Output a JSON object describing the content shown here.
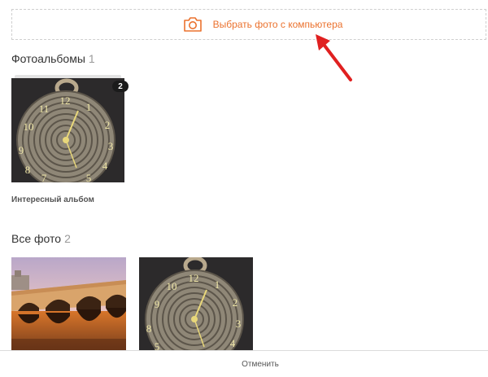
{
  "upload": {
    "label": "Выбрать фото с компьютера",
    "icon": "camera-icon",
    "color": "#eb722e"
  },
  "annotation": {
    "icon": "red-arrow-icon",
    "color": "#e02020"
  },
  "albums_section": {
    "title": "Фотоальбомы",
    "count": "1"
  },
  "albums": [
    {
      "name": "Интересный альбом",
      "photo_count": "2",
      "numerals": [
        "12",
        "1",
        "2",
        "3",
        "4",
        "5",
        "7",
        "8",
        "9",
        "10",
        "11"
      ]
    }
  ],
  "photos_section": {
    "title": "Все фото",
    "count": "2"
  },
  "photos": [
    {
      "kind": "bridge-landscape"
    },
    {
      "kind": "rope-clock",
      "numerals": [
        "12",
        "1",
        "2",
        "3",
        "4",
        "5",
        "8",
        "9",
        "10",
        "11"
      ]
    }
  ],
  "footer": {
    "cancel_label": "Отменить"
  }
}
